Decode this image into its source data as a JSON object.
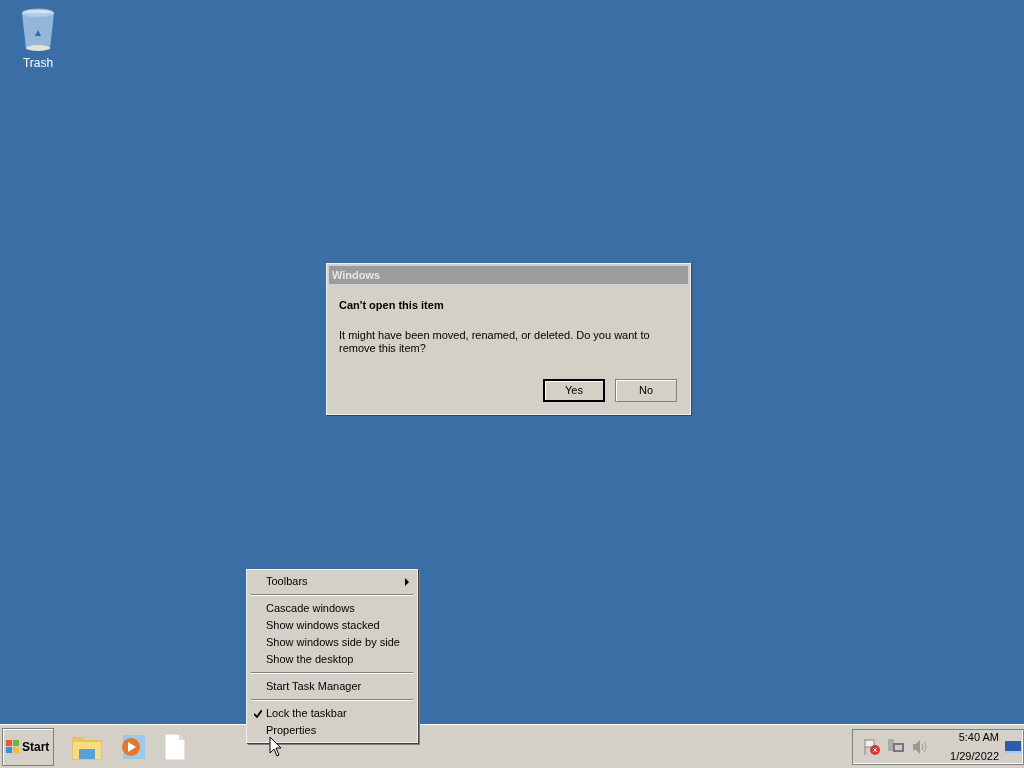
{
  "desktop_icons": [
    {
      "label": "Trash"
    }
  ],
  "dialog": {
    "title": "Windows",
    "heading": "Can't open this item",
    "message": "It might have been moved, renamed, or deleted. Do you want to remove this item?",
    "buttons": [
      {
        "label": "Yes",
        "default": true
      },
      {
        "label": "No",
        "default": false
      }
    ]
  },
  "context_menu": {
    "items": [
      {
        "kind": "item",
        "label": "Toolbars",
        "submenu": true,
        "checked": false
      },
      {
        "kind": "separator"
      },
      {
        "kind": "item",
        "label": "Cascade windows",
        "submenu": false,
        "checked": false
      },
      {
        "kind": "item",
        "label": "Show windows stacked",
        "submenu": false,
        "checked": false
      },
      {
        "kind": "item",
        "label": "Show windows side by side",
        "submenu": false,
        "checked": false
      },
      {
        "kind": "item",
        "label": "Show the desktop",
        "submenu": false,
        "checked": false
      },
      {
        "kind": "separator"
      },
      {
        "kind": "item",
        "label": "Start Task Manager",
        "submenu": false,
        "checked": false
      },
      {
        "kind": "separator"
      },
      {
        "kind": "item",
        "label": "Lock the taskbar",
        "submenu": false,
        "checked": true
      },
      {
        "kind": "item",
        "label": "Properties",
        "submenu": false,
        "checked": false
      }
    ]
  },
  "taskbar": {
    "start_label": "Start",
    "pinned": [
      {
        "kind": "folder"
      },
      {
        "kind": "media"
      },
      {
        "kind": "document"
      }
    ],
    "tray": {
      "time": "5:40 AM",
      "date": "1/29/2022"
    }
  }
}
